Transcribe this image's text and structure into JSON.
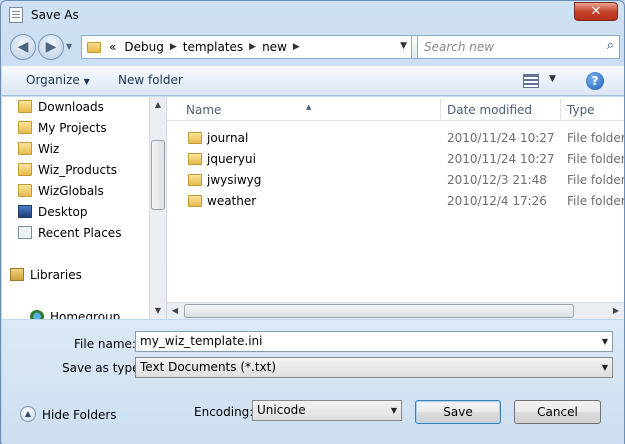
{
  "window": {
    "title": "Save As",
    "close_label": "✕"
  },
  "navbar": {
    "back_glyph": "◀",
    "forward_glyph": "▶",
    "breadcrumb": [
      "«",
      "Debug",
      "templates",
      "new"
    ],
    "search_placeholder": "Search new"
  },
  "toolbar": {
    "organize_label": "Organize",
    "new_folder_label": "New folder",
    "help_label": "?"
  },
  "sidebar": {
    "items": [
      {
        "label": "Downloads",
        "icon": "folder-icon"
      },
      {
        "label": "My Projects",
        "icon": "folder-icon"
      },
      {
        "label": "Wiz",
        "icon": "folder-icon"
      },
      {
        "label": "Wiz_Products",
        "icon": "folder-icon"
      },
      {
        "label": "WizGlobals",
        "icon": "folder-icon"
      },
      {
        "label": "Desktop",
        "icon": "desktop-icon"
      },
      {
        "label": "Recent Places",
        "icon": "recent-places-icon"
      },
      {
        "label": "Libraries",
        "icon": "libraries-icon"
      },
      {
        "label": "Homegroup",
        "icon": "homegroup-icon"
      }
    ]
  },
  "file_list": {
    "columns": [
      "Name",
      "Date modified",
      "Type"
    ],
    "rows": [
      {
        "name": "journal",
        "date": "2010/11/24 10:27",
        "type": "File folder"
      },
      {
        "name": "jqueryui",
        "date": "2010/11/24 10:27",
        "type": "File folder"
      },
      {
        "name": "jwysiwyg",
        "date": "2010/12/3 21:48",
        "type": "File folder"
      },
      {
        "name": "weather",
        "date": "2010/12/4 17:26",
        "type": "File folder"
      }
    ]
  },
  "form": {
    "file_name_label": "File name:",
    "file_name_value": "my_wiz_template.ini",
    "save_type_label": "Save as type:",
    "save_type_value": "Text Documents (*.txt)",
    "encoding_label": "Encoding:",
    "encoding_value": "Unicode"
  },
  "footer": {
    "hide_folders_label": "Hide Folders",
    "save_label": "Save",
    "cancel_label": "Cancel"
  }
}
